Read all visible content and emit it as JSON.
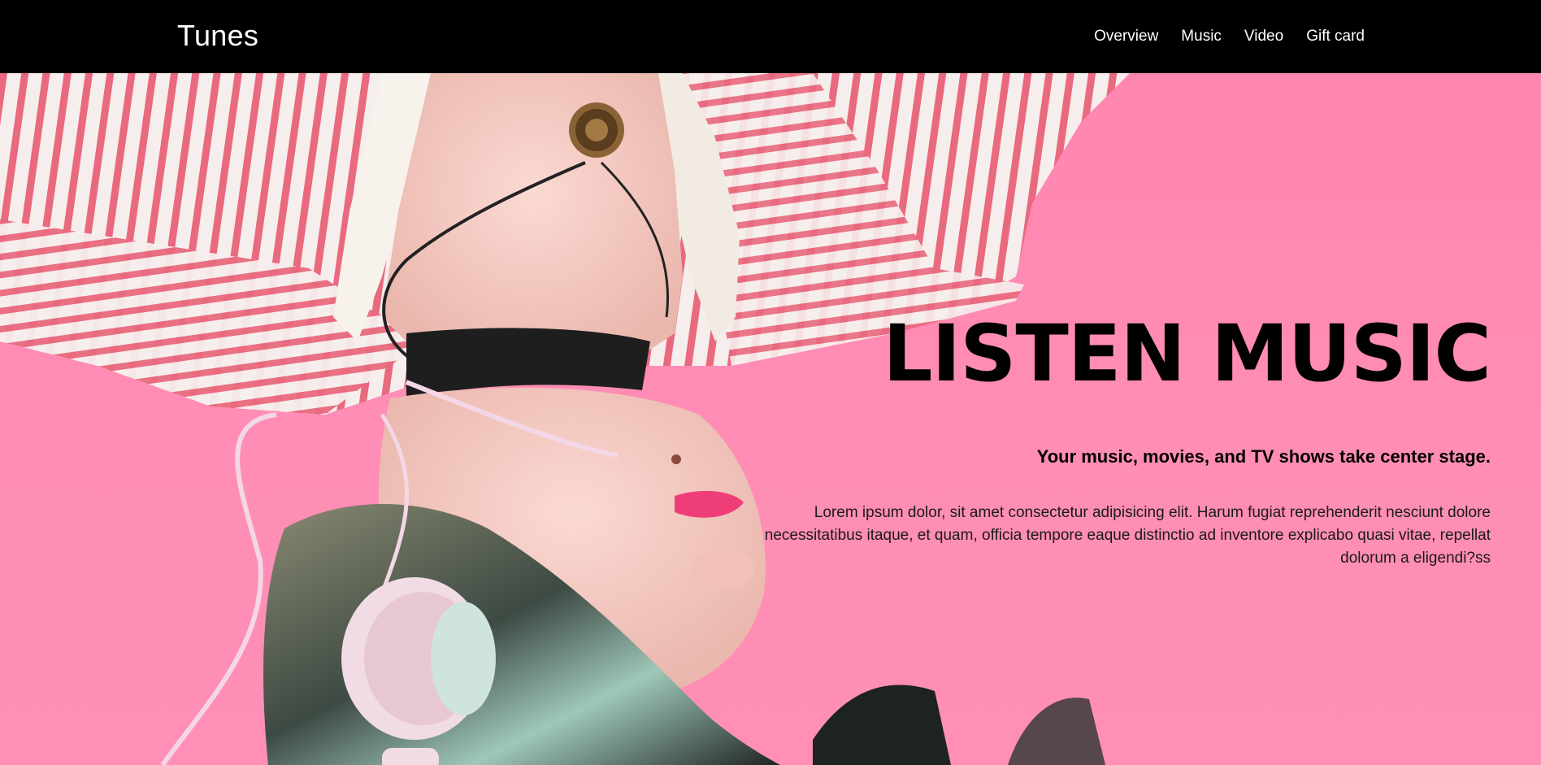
{
  "header": {
    "brand": "Tunes",
    "nav": [
      {
        "label": "Overview"
      },
      {
        "label": "Music"
      },
      {
        "label": "Video"
      },
      {
        "label": "Gift card"
      }
    ]
  },
  "hero": {
    "title": "LISTEN MUSIC",
    "subtitle": "Your music, movies, and TV shows take center stage.",
    "body": "Lorem ipsum dolor, sit amet consectetur adipisicing elit. Harum fugiat reprehenderit nesciunt dolore necessitatibus itaque, et quam, officia tempore eaque distinctio ad inventore explicabo quasi vitae, repellat dolorum a eligendi?ss",
    "image": "woman-with-headphones-lying-upside-down-photo"
  },
  "colors": {
    "header_bg": "#000000",
    "hero_bg": "#ff8fb4",
    "text": "#000000",
    "nav_text": "#ffffff"
  }
}
